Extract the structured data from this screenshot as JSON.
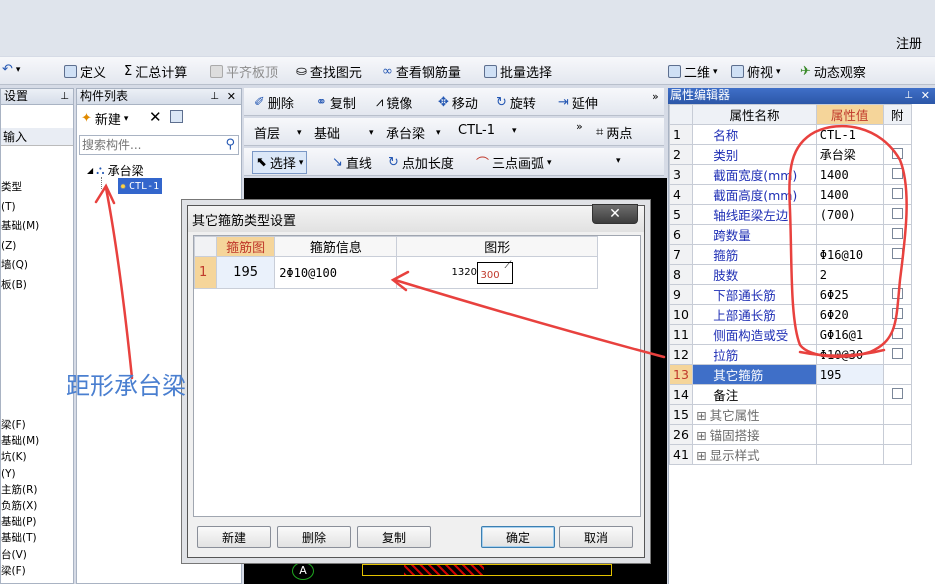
{
  "top_right": {
    "register_label": "注册"
  },
  "toolbar_main": {
    "define": "定义",
    "sum": "汇总计算",
    "flat_slab": "平齐板顶",
    "find_element": "查找图元",
    "view_rebar": "查看钢筋量",
    "batch_select": "批量选择",
    "view2d": "二维",
    "top_view": "俯视",
    "dynamic": "动态观察"
  },
  "left_panel": {
    "title_fragment": "设置",
    "input_fragment": "输入",
    "items_top": [
      "类型",
      "(T)",
      "基础(M)",
      "(Z)",
      "墙(Q)",
      "板(B)"
    ],
    "items_bottom": [
      "梁(F)",
      "基础(M)",
      "坑(K)",
      "(Y)",
      "主筋(R)",
      "负筋(X)",
      "基础(P)",
      "基础(T)",
      "台(V)",
      "梁(F)"
    ]
  },
  "component_list": {
    "title": "构件列表",
    "new_label": "新建",
    "search_placeholder": "搜索构件...",
    "tree_root": "承台梁",
    "tree_child": "CTL-1"
  },
  "edit_toolbar": {
    "delete": "删除",
    "copy": "复制",
    "mirror": "镜像",
    "move": "移动",
    "rotate": "旋转",
    "extend": "延伸",
    "floor": "首层",
    "category": "基础",
    "type": "承台梁",
    "element": "CTL-1",
    "two_point": "两点",
    "select": "选择",
    "line": "直线",
    "add_length": "点加长度",
    "arc": "三点画弧"
  },
  "property_editor": {
    "title": "属性编辑器",
    "col_name": "属性名称",
    "col_value": "属性值",
    "col_extra": "附",
    "rows": [
      {
        "num": "1",
        "name": "名称",
        "value": "CTL-1",
        "cb": false
      },
      {
        "num": "2",
        "name": "类别",
        "value": "承台梁",
        "cb": true
      },
      {
        "num": "3",
        "name": "截面宽度(mm)",
        "value": "1400",
        "cb": true
      },
      {
        "num": "4",
        "name": "截面高度(mm)",
        "value": "1400",
        "cb": true
      },
      {
        "num": "5",
        "name": "轴线距梁左边",
        "value": "(700)",
        "cb": true
      },
      {
        "num": "6",
        "name": "跨数量",
        "value": "",
        "cb": true
      },
      {
        "num": "7",
        "name": "箍筋",
        "value": "Φ16@10",
        "cb": true
      },
      {
        "num": "8",
        "name": "肢数",
        "value": "2",
        "cb": false
      },
      {
        "num": "9",
        "name": "下部通长筋",
        "value": "6Φ25",
        "cb": true
      },
      {
        "num": "10",
        "name": "上部通长筋",
        "value": "6Φ20",
        "cb": true
      },
      {
        "num": "11",
        "name": "侧面构造或受",
        "value": "GΦ16@1",
        "cb": true
      },
      {
        "num": "12",
        "name": "拉筋",
        "value": "Φ10@30",
        "cb": true
      },
      {
        "num": "13",
        "name": "其它箍筋",
        "value": "195",
        "cb": false
      },
      {
        "num": "14",
        "name": "备注",
        "value": "",
        "cb": true
      },
      {
        "num": "15",
        "name": "其它属性",
        "value": "",
        "cb": false
      },
      {
        "num": "26",
        "name": "锚固搭接",
        "value": "",
        "cb": false
      },
      {
        "num": "41",
        "name": "显示样式",
        "value": "",
        "cb": false
      }
    ]
  },
  "annotation": {
    "label": "距形承台梁"
  },
  "dialog": {
    "title": "其它箍筋类型设置",
    "col_row": "",
    "col_stirrup": "箍筋图",
    "col_info": "箍筋信息",
    "col_shape": "图形",
    "row": {
      "num": "1",
      "stirrup": "195",
      "info": "2Φ10@100",
      "shape_w": "1320",
      "shape_h": "300"
    },
    "buttons": {
      "new": "新建",
      "delete": "删除",
      "copy": "复制",
      "ok": "确定",
      "cancel": "取消"
    }
  },
  "canvas_bottom": {
    "axis_label": "A"
  }
}
